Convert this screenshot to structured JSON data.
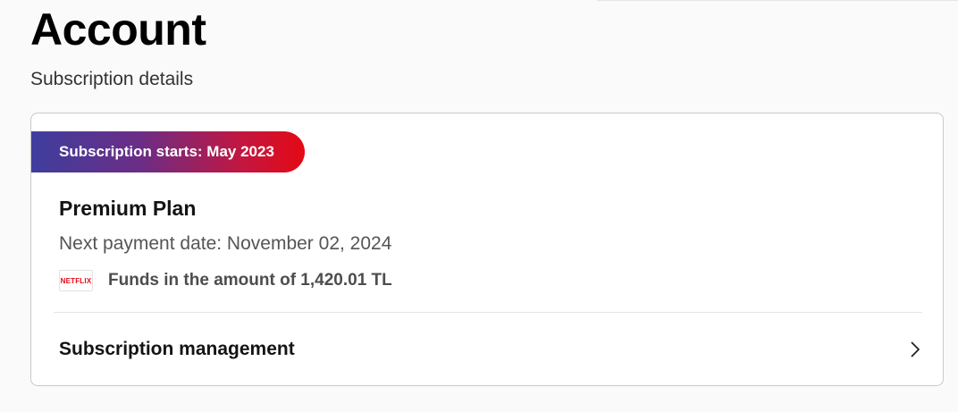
{
  "page": {
    "title": "Account",
    "subtitle": "Subscription details"
  },
  "subscription": {
    "start_badge": "Subscription starts: May 2023",
    "plan_name": "Premium Plan",
    "next_payment": "Next payment date: November 02, 2024",
    "provider_logo_text": "NETFLIX",
    "funds": "Funds in the amount of 1,420.01 TL",
    "management_label": "Subscription management"
  },
  "icons": {
    "management_chevron": "chevron-right-icon",
    "provider_logo": "netflix-logo"
  },
  "colors": {
    "badge_gradient_start": "#3f3e9e",
    "badge_gradient_end": "#e50914",
    "netflix_red": "#e50914"
  }
}
